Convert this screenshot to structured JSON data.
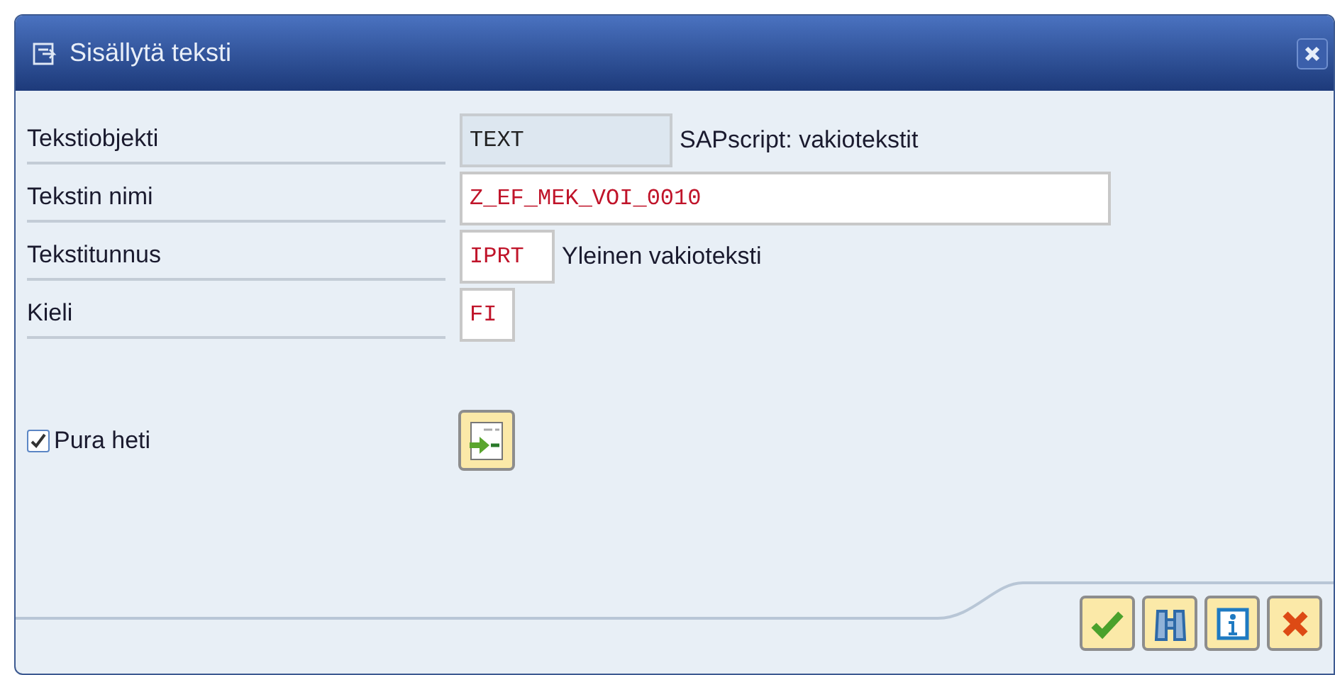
{
  "window": {
    "title": "Sisällytä teksti"
  },
  "fields": [
    {
      "label": "Tekstiobjekti",
      "value": "TEXT",
      "editable": false,
      "description": "SAPscript: vakiotekstit"
    },
    {
      "label": "Tekstin nimi",
      "value": "Z_EF_MEK_VOI_0010",
      "editable": true
    },
    {
      "label": "Tekstitunnus",
      "value": "IPRT",
      "editable": true,
      "description": "Yleinen vakioteksti"
    },
    {
      "label": "Kieli",
      "value": "FI",
      "editable": true
    }
  ],
  "checkbox": {
    "label": "Pura heti",
    "checked": true
  },
  "buttons": [
    {
      "kind": "ok"
    },
    {
      "kind": "find"
    },
    {
      "kind": "info"
    },
    {
      "kind": "cancel"
    }
  ]
}
